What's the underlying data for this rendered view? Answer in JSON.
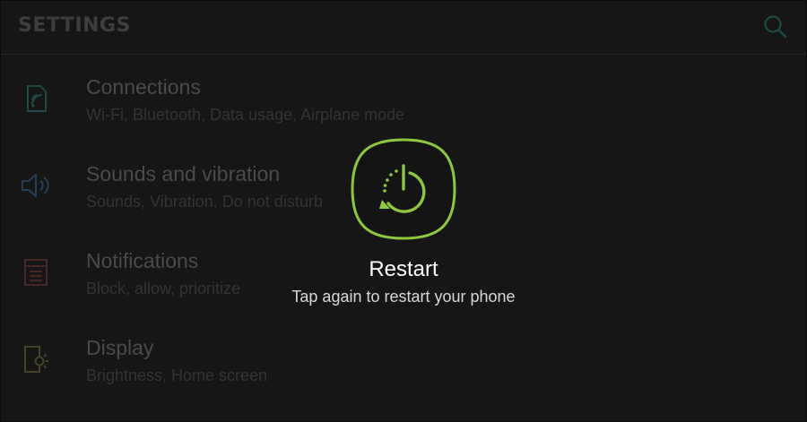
{
  "app": {
    "title": "SETTINGS",
    "search_icon": "search-icon"
  },
  "settings": {
    "items": [
      {
        "key": "connections",
        "label": "Connections",
        "subtitle": "Wi-Fi, Bluetooth, Data usage, Airplane mode",
        "icon": "connections-icon",
        "icon_color": "#1f4a46"
      },
      {
        "key": "sounds",
        "label": "Sounds and vibration",
        "subtitle": "Sounds, Vibration, Do not disturb",
        "icon": "speaker-icon",
        "icon_color": "#283f57"
      },
      {
        "key": "notifications",
        "label": "Notifications",
        "subtitle": "Block, allow, prioritize",
        "icon": "notifications-icon",
        "icon_color": "#4a2727"
      },
      {
        "key": "display",
        "label": "Display",
        "subtitle": "Brightness, Home screen",
        "icon": "display-icon",
        "icon_color": "#474428"
      }
    ]
  },
  "restart_dialog": {
    "label": "Restart",
    "hint": "Tap again to restart your phone",
    "icon": "restart-icon",
    "accent_color": "#8dc63f"
  }
}
